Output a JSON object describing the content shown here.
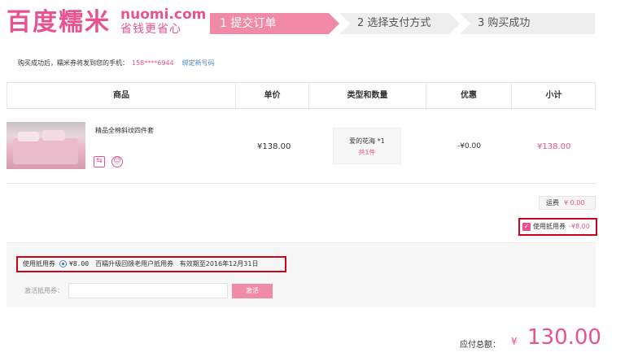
{
  "logo": {
    "main": "百度糯米",
    "domain": "nuomi.com",
    "slogan": "省钱更省心"
  },
  "steps": [
    {
      "label": "1 提交订单",
      "active": true
    },
    {
      "label": "2 选择支付方式",
      "active": false
    },
    {
      "label": "3 购买成功",
      "active": false
    }
  ],
  "notice": {
    "text": "购买成功后，糯米券将发到您的手机：",
    "phone": "158****6944",
    "bind_link": "绑定新号码"
  },
  "table": {
    "headers": [
      "商品",
      "单价",
      "类型和数量",
      "优惠",
      "小计"
    ],
    "product": {
      "name": "精品全棉斜纹四件套",
      "price": "¥138.00",
      "type_name": "爱的花海 *1",
      "type_count": "共1件",
      "discount": "-¥0.00",
      "subtotal": "¥138.00"
    }
  },
  "shipping": {
    "label": "运费",
    "value": "¥ 0.00"
  },
  "use_coupon": {
    "label": "使用抵用券",
    "value": "-¥8.00",
    "checked": true
  },
  "coupon": {
    "label": "使用抵用券",
    "amount": "¥8.00",
    "desc": "百糯升级回馈老用户抵用券",
    "expiry": "有效期至2016年12月31日",
    "activate_label": "激活抵用券：",
    "activate_button": "激活"
  },
  "total": {
    "label": "应付总额：",
    "currency": "¥",
    "value": "130.00"
  },
  "colors": {
    "brand": "#e9528f",
    "step_active": "#f08aa7",
    "highlight_border": "#d0021b"
  }
}
